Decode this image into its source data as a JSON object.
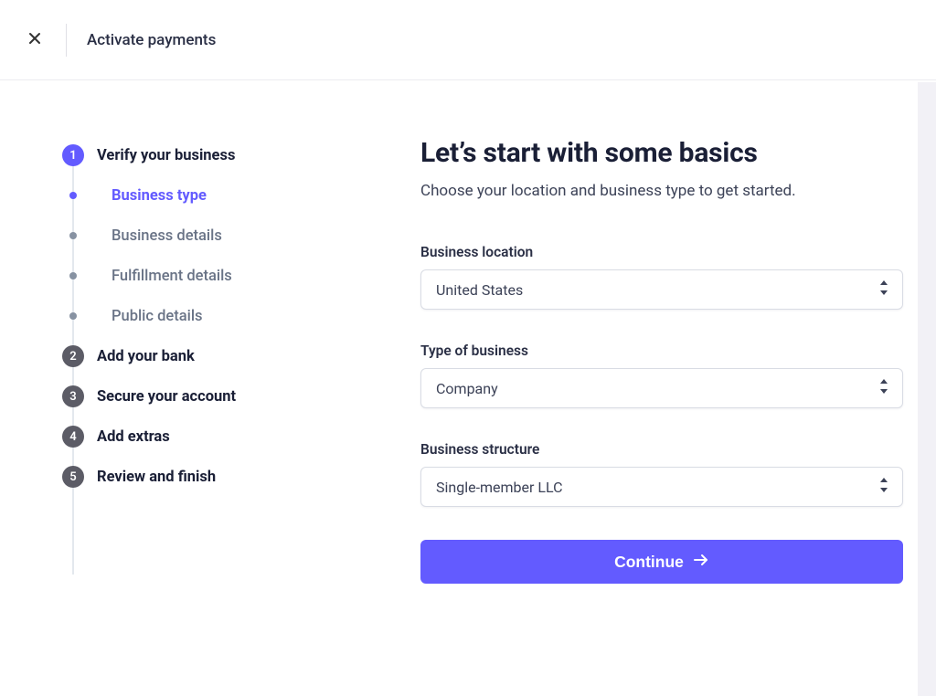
{
  "header": {
    "title": "Activate payments"
  },
  "sidebar": {
    "steps": [
      {
        "num": "1",
        "label": "Verify your business",
        "current": true,
        "subs": [
          {
            "label": "Business type",
            "active": true
          },
          {
            "label": "Business details",
            "active": false
          },
          {
            "label": "Fulfillment details",
            "active": false
          },
          {
            "label": "Public details",
            "active": false
          }
        ]
      },
      {
        "num": "2",
        "label": "Add your bank"
      },
      {
        "num": "3",
        "label": "Secure your account"
      },
      {
        "num": "4",
        "label": "Add extras"
      },
      {
        "num": "5",
        "label": "Review and finish"
      }
    ]
  },
  "main": {
    "heading": "Let’s start with some basics",
    "subheading": "Choose your location and business type to get started.",
    "fields": {
      "location": {
        "label": "Business location",
        "value": "United States"
      },
      "type": {
        "label": "Type of business",
        "value": "Company"
      },
      "structure": {
        "label": "Business structure",
        "value": "Single-member LLC"
      }
    },
    "continue_label": "Continue"
  },
  "icons": {
    "close": "close-icon",
    "chevron_updown": "chevron-updown-icon",
    "arrow_right": "arrow-right-icon"
  },
  "colors": {
    "accent": "#635bff"
  }
}
